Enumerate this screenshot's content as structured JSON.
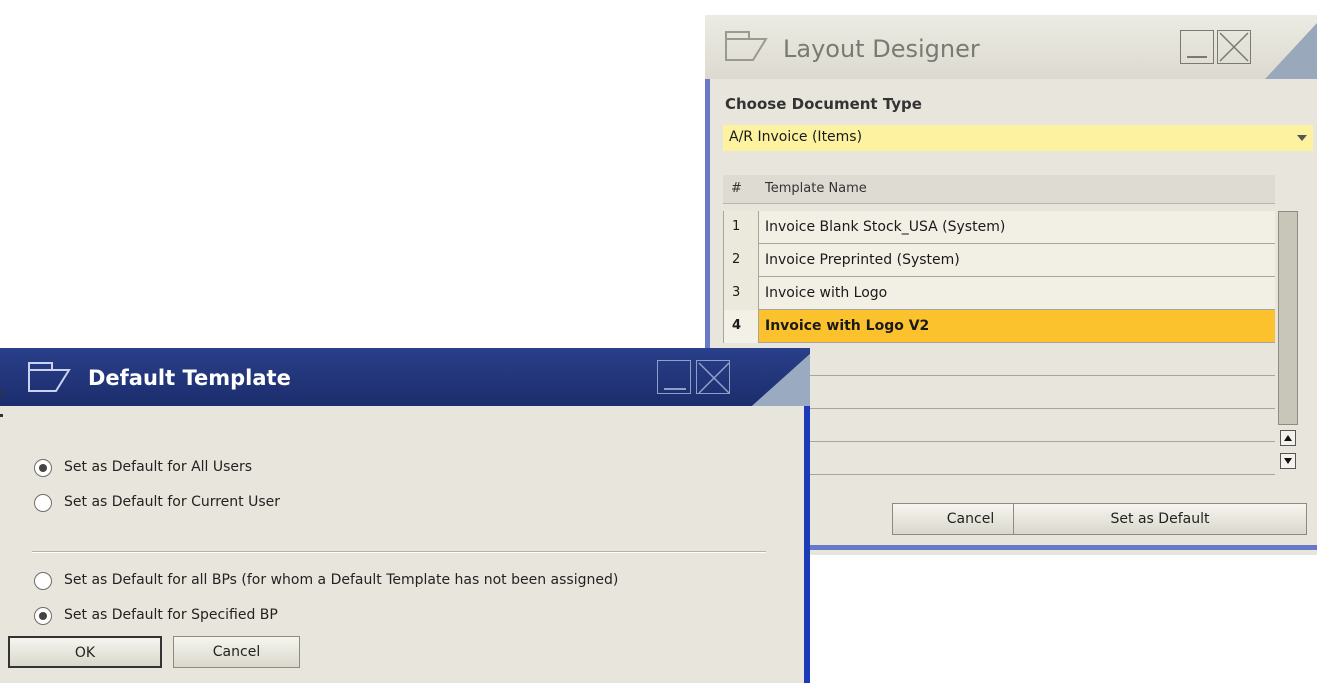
{
  "layout_designer": {
    "title": "Layout Designer",
    "doc_type_label": "Choose Document Type",
    "doc_type_value": "A/R Invoice (Items)",
    "grid_header": {
      "num": "#",
      "name": "Template Name"
    },
    "rows": [
      {
        "num": "1",
        "name": "Invoice Blank Stock_USA (System)",
        "selected": false
      },
      {
        "num": "2",
        "name": "Invoice Preprinted (System)",
        "selected": false
      },
      {
        "num": "3",
        "name": "Invoice with Logo",
        "selected": false
      },
      {
        "num": "4",
        "name": "Invoice with Logo V2",
        "selected": true
      }
    ],
    "cancel_label": "Cancel",
    "set_default_label": "Set as Default"
  },
  "default_template": {
    "title": "Default Template",
    "options": [
      {
        "label": "Set as Default for All Users",
        "checked": true
      },
      {
        "label": "Set as Default for Current User",
        "checked": false
      },
      {
        "label": "Set as Default for all BPs (for whom a Default Template has not been assigned)",
        "checked": false
      },
      {
        "label": "Set as Default for Specified BP",
        "checked": true
      }
    ],
    "ok_label": "OK",
    "cancel_label": "Cancel"
  },
  "colors": {
    "selected_row": "#fbc22e",
    "doc_type_field": "#fdf2a0",
    "active_titlebar": "#1c2d6c",
    "window_body": "#e8e6dc"
  }
}
